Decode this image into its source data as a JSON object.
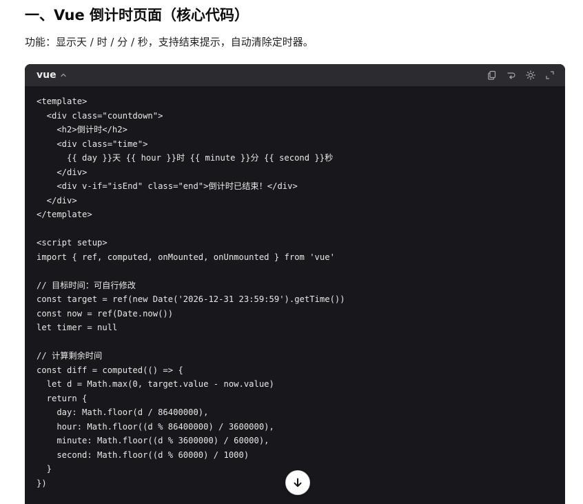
{
  "section": {
    "heading": "一、Vue 倒计时页面（核心代码）",
    "description": "功能：显示天 / 时 / 分 / 秒，支持结束提示，自动清除定时器。"
  },
  "code_block": {
    "language": "vue",
    "collapse_icon": "chevron-up-icon",
    "toolbar_icons": [
      "copy-icon",
      "wrap-icon",
      "theme-icon",
      "expand-icon"
    ],
    "lines": [
      "<template>",
      "  <div class=\"countdown\">",
      "    <h2>倒计时</h2>",
      "    <div class=\"time\">",
      "      {{ day }}天 {{ hour }}时 {{ minute }}分 {{ second }}秒",
      "    </div>",
      "    <div v-if=\"isEnd\" class=\"end\">倒计时已结束！</div>",
      "  </div>",
      "</template>",
      "",
      "<script setup>",
      "import { ref, computed, onMounted, onUnmounted } from 'vue'",
      "",
      "// 目标时间：可自行修改",
      "const target = ref(new Date('2026-12-31 23:59:59').getTime())",
      "const now = ref(Date.now())",
      "let timer = null",
      "",
      "// 计算剩余时间",
      "const diff = computed(() => {",
      "  let d = Math.max(0, target.value - now.value)",
      "  return {",
      "    day: Math.floor(d / 86400000),",
      "    hour: Math.floor((d % 86400000) / 3600000),",
      "    minute: Math.floor((d % 3600000) / 60000),",
      "    second: Math.floor((d % 60000) / 1000)",
      "  }",
      "})"
    ]
  },
  "scroll_button": {
    "icon": "arrow-down-icon"
  }
}
